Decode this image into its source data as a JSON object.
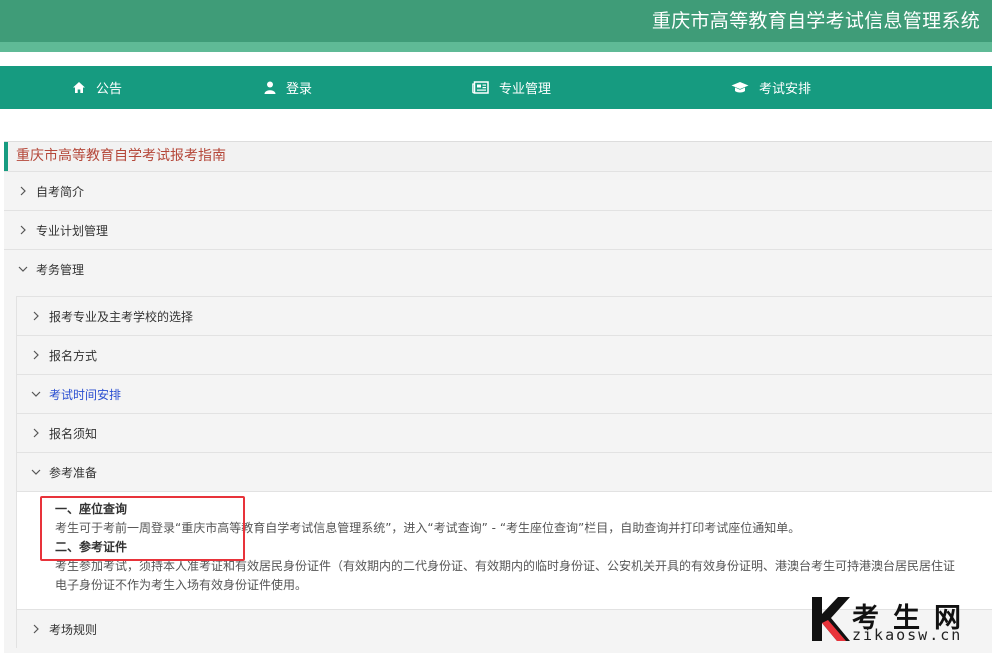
{
  "header": {
    "title": "重庆市高等教育自学考试信息管理系统"
  },
  "nav": [
    {
      "label": "公告",
      "icon": "home-icon"
    },
    {
      "label": "登录",
      "icon": "user-icon"
    },
    {
      "label": "专业管理",
      "icon": "newspaper-icon"
    },
    {
      "label": "考试安排",
      "icon": "graduation-cap-icon"
    }
  ],
  "guide": {
    "title": "重庆市高等教育自学考试报考指南",
    "top_items": [
      "自考简介",
      "专业计划管理",
      "考务管理"
    ],
    "sub_items": [
      "报考专业及主考学校的选择",
      "报名方式",
      "考试时间安排",
      "报名须知",
      "参考准备",
      "考场规则"
    ],
    "content": {
      "h1": "一、座位查询",
      "p1": "考生可于考前一周登录“重庆市高等教育自学考试信息管理系统”，进入“考试查询” - “考生座位查询”栏目，自助查询并打印考试座位通知单。",
      "h2": "二、参考证件",
      "p2": "考生参加考试，须持本人准考证和有效居民身份证件（有效期内的二代身份证、有效期内的临时身份证、公安机关开具的有效身份证明、港澳台考生可持港澳台居民居住证",
      "p3": "电子身份证不作为考生入场有效身份证件使用。"
    }
  },
  "watermark": {
    "cn": "考生网",
    "en": "zikaosw.cn"
  },
  "colors": {
    "header": "#3f9c78",
    "nav": "#169b80",
    "title_text": "#b5483a",
    "active_link": "#2b4fd1",
    "highlight_box": "#e8333a"
  }
}
